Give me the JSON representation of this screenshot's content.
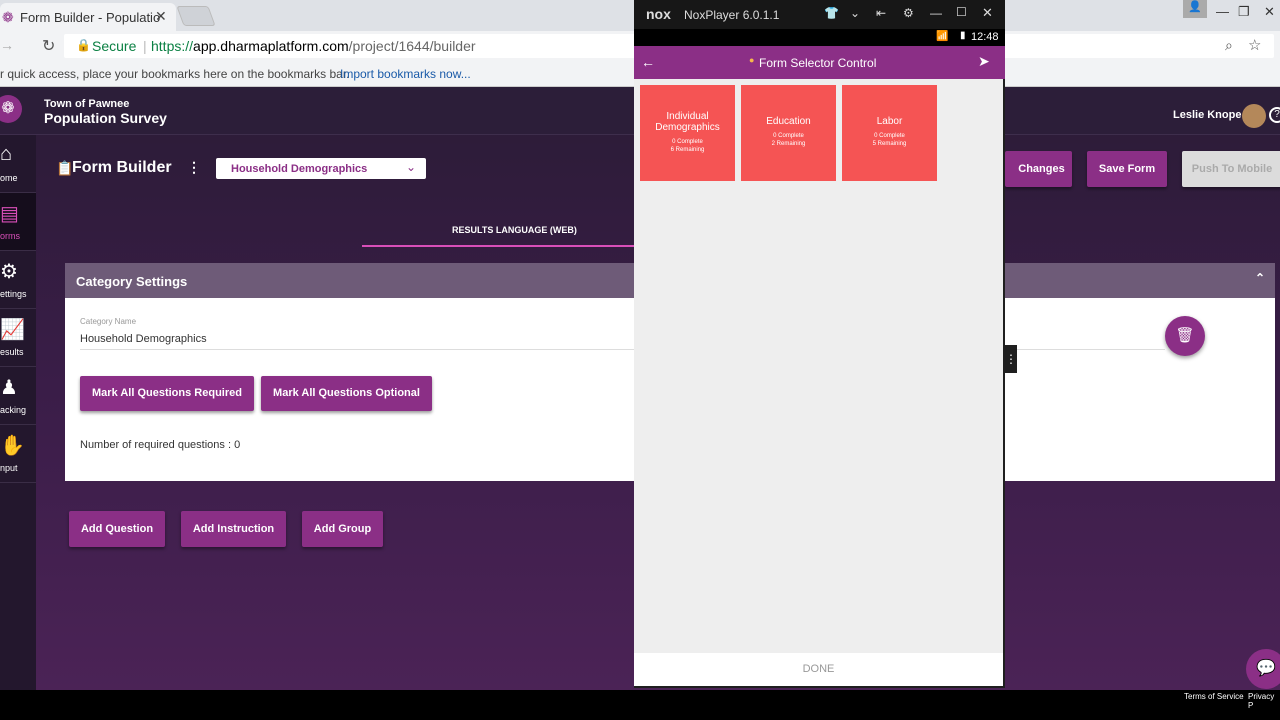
{
  "browser": {
    "tab_title": "Form Builder - Populatio",
    "tab_close": "✕",
    "secure_label": "Secure",
    "url_scheme": "https://",
    "url_host": "app.dharmaplatform.com",
    "url_path": "/project/1644/builder",
    "bookmarks_text": "r quick access, place your bookmarks here on the bookmarks bar.",
    "bookmarks_link": "Import bookmarks now..."
  },
  "header": {
    "org": "Town of Pawnee",
    "project": "Population Survey",
    "user": "Leslie Knope"
  },
  "sidebar": {
    "items": [
      {
        "label": "ome",
        "icon": "home-icon"
      },
      {
        "label": "orms",
        "icon": "forms-icon"
      },
      {
        "label": "ettings",
        "icon": "gear-icon"
      },
      {
        "label": "esults",
        "icon": "chart-icon"
      },
      {
        "label": "acking",
        "icon": "person-icon"
      },
      {
        "label": "nput",
        "icon": "hand-icon"
      }
    ]
  },
  "builder": {
    "title": "Form Builder",
    "category_select": "Household Demographics",
    "results_tab": "RESULTS LANGUAGE (WEB)",
    "changes_btn": "Changes",
    "save_btn": "Save Form",
    "push_btn": "Push To Mobile"
  },
  "category": {
    "header": "Category Settings",
    "name_label": "Category Name",
    "name_value": "Household Demographics",
    "required_btn": "Mark All Questions Required",
    "optional_btn": "Mark All Questions Optional",
    "required_count": "Number of required questions : 0"
  },
  "actions": {
    "add_question": "Add Question",
    "add_instruction": "Add Instruction",
    "add_group": "Add Group"
  },
  "nox": {
    "title": "NoxPlayer 6.0.1.1",
    "time": "12:48",
    "screen_title": "Form Selector Control",
    "tiles": [
      {
        "name": "Individual Demographics",
        "complete": "0 Complete",
        "remaining": "6 Remaining"
      },
      {
        "name": "Education",
        "complete": "0 Complete",
        "remaining": "2 Remaining"
      },
      {
        "name": "Labor",
        "complete": "0 Complete",
        "remaining": "5 Remaining"
      }
    ],
    "done": "DONE"
  },
  "footer": {
    "terms": "Terms of Service",
    "privacy": "Privacy P"
  }
}
